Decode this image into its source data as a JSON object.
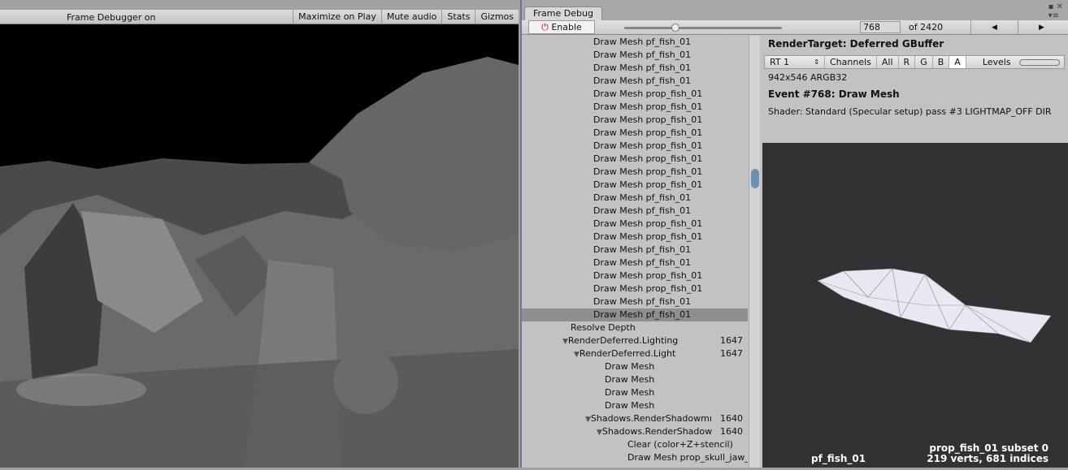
{
  "game": {
    "title": "Frame Debugger on",
    "buttons": [
      "Maximize on Play",
      "Mute audio",
      "Stats",
      "Gizmos"
    ]
  },
  "debugger": {
    "tab": "Frame Debug",
    "enable_label": "Enable",
    "event_index": "768",
    "event_total": "of 2420",
    "slider_fraction": 0.317,
    "prev_icon": "arrow-left-icon",
    "next_icon": "arrow-right-icon",
    "list": [
      {
        "label": "Draw Mesh pf_fish_01",
        "indent": 3
      },
      {
        "label": "Draw Mesh pf_fish_01",
        "indent": 3
      },
      {
        "label": "Draw Mesh pf_fish_01",
        "indent": 3
      },
      {
        "label": "Draw Mesh pf_fish_01",
        "indent": 3
      },
      {
        "label": "Draw Mesh prop_fish_01",
        "indent": 3
      },
      {
        "label": "Draw Mesh prop_fish_01",
        "indent": 3
      },
      {
        "label": "Draw Mesh prop_fish_01",
        "indent": 3
      },
      {
        "label": "Draw Mesh prop_fish_01",
        "indent": 3
      },
      {
        "label": "Draw Mesh prop_fish_01",
        "indent": 3
      },
      {
        "label": "Draw Mesh prop_fish_01",
        "indent": 3
      },
      {
        "label": "Draw Mesh prop_fish_01",
        "indent": 3
      },
      {
        "label": "Draw Mesh prop_fish_01",
        "indent": 3
      },
      {
        "label": "Draw Mesh pf_fish_01",
        "indent": 3
      },
      {
        "label": "Draw Mesh pf_fish_01",
        "indent": 3
      },
      {
        "label": "Draw Mesh prop_fish_01",
        "indent": 3
      },
      {
        "label": "Draw Mesh prop_fish_01",
        "indent": 3
      },
      {
        "label": "Draw Mesh pf_fish_01",
        "indent": 3
      },
      {
        "label": "Draw Mesh pf_fish_01",
        "indent": 3
      },
      {
        "label": "Draw Mesh prop_fish_01",
        "indent": 3
      },
      {
        "label": "Draw Mesh prop_fish_01",
        "indent": 3
      },
      {
        "label": "Draw Mesh pf_fish_01",
        "indent": 3
      },
      {
        "label": "Draw Mesh pf_fish_01",
        "indent": 3,
        "selected": true
      },
      {
        "label": "Resolve Depth",
        "indent": 2
      },
      {
        "label": "RenderDeferred.Lighting",
        "indent": 1,
        "expanded": true,
        "count": "1647"
      },
      {
        "label": "RenderDeferred.Light",
        "indent": 2,
        "expanded": true,
        "count": "1647"
      },
      {
        "label": "Draw Mesh",
        "indent": 4
      },
      {
        "label": "Draw Mesh",
        "indent": 4
      },
      {
        "label": "Draw Mesh",
        "indent": 4
      },
      {
        "label": "Draw Mesh",
        "indent": 4
      },
      {
        "label": "Shadows.RenderShadowmı",
        "indent": 3,
        "expanded": true,
        "count": "1640"
      },
      {
        "label": "Shadows.RenderShadow",
        "indent": 4,
        "expanded": true,
        "count": "1640"
      },
      {
        "label": "Clear (color+Z+stencil)",
        "indent": 6
      },
      {
        "label": "Draw Mesh prop_skull_jaw_(",
        "indent": 6
      }
    ],
    "details": {
      "render_target": "RenderTarget: Deferred GBuffer",
      "rt_select": "RT 1",
      "channels_label": "Channels",
      "channels": [
        "All",
        "R",
        "G",
        "B",
        "A"
      ],
      "active_channel": "A",
      "levels_label": "Levels",
      "format": "942x546 ARGB32",
      "event": "Event #768: Draw Mesh",
      "shader": "Shader: Standard (Specular setup) pass #3  LIGHTMAP_OFF DIR",
      "preview_object": "pf_fish_01",
      "preview_mesh": "prop_fish_01 subset 0",
      "preview_stats": "219 verts, 681 indices"
    }
  }
}
